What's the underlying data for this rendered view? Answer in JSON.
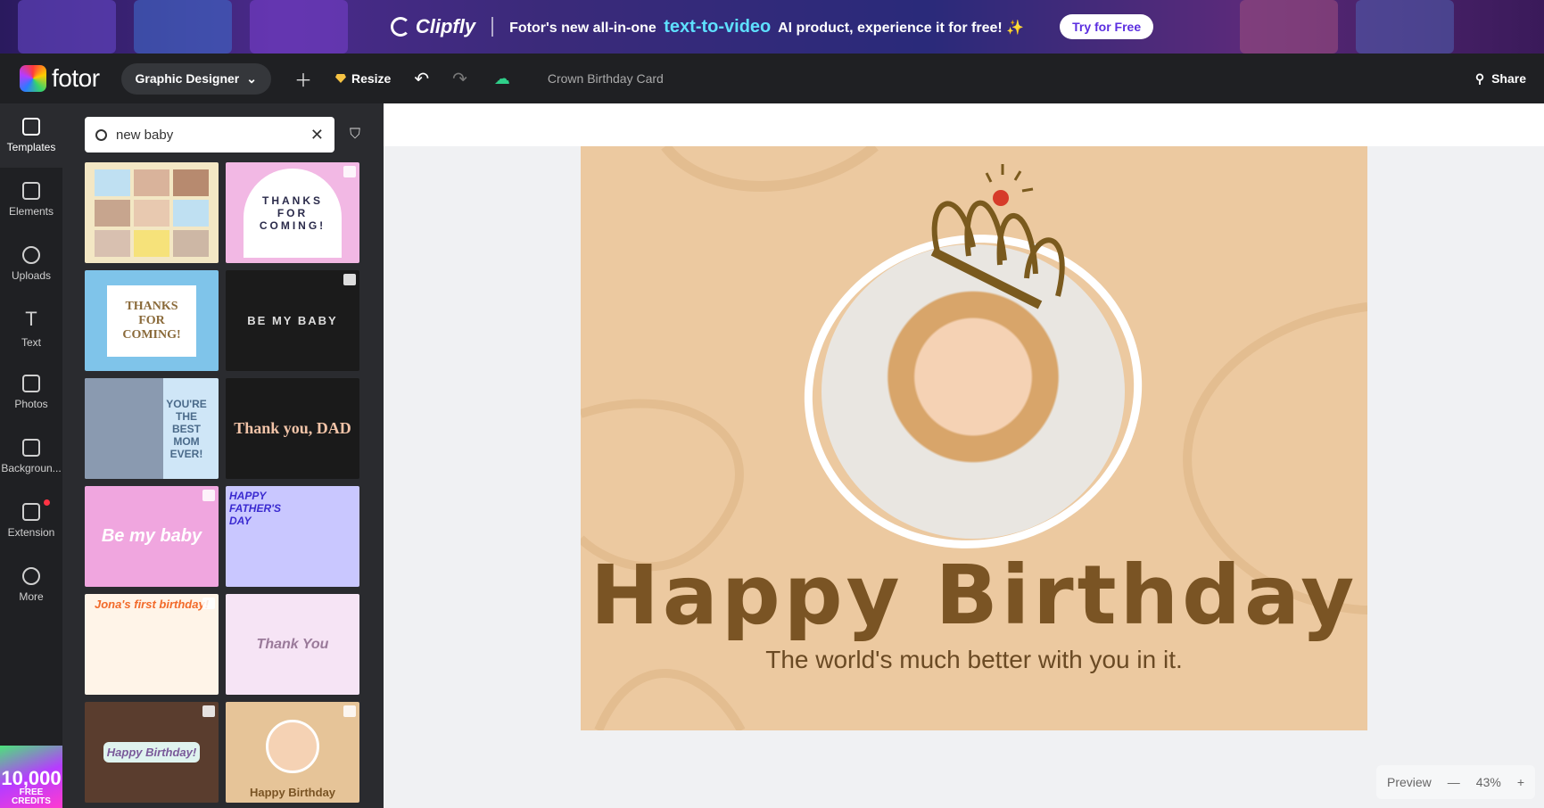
{
  "banner": {
    "brand": "Clipfly",
    "message_pre": "Fotor's new all-in-one",
    "message_highlight": "text-to-video",
    "message_post": "AI product, experience it for free!",
    "sparkle": "✨",
    "cta": "Try for Free"
  },
  "topbar": {
    "logo": "fotor",
    "role": "Graphic Designer",
    "resize": "Resize",
    "doc_title": "Crown Birthday Card",
    "share": "Share"
  },
  "rail": {
    "items": [
      {
        "label": "Templates",
        "icon": "templates-icon"
      },
      {
        "label": "Elements",
        "icon": "elements-icon"
      },
      {
        "label": "Uploads",
        "icon": "upload-icon"
      },
      {
        "label": "Text",
        "icon": "text-icon"
      },
      {
        "label": "Photos",
        "icon": "photos-icon"
      },
      {
        "label": "Backgroun...",
        "icon": "background-icon"
      },
      {
        "label": "Extension",
        "icon": "extension-icon"
      },
      {
        "label": "More",
        "icon": "more-icon"
      }
    ],
    "credits_big": "10,000",
    "credits_small": "FREE CREDITS"
  },
  "search": {
    "value": "new baby"
  },
  "templates": [
    {
      "text": "",
      "bg": "#f3e7c4"
    },
    {
      "text": "THANKS FOR COMING!",
      "bg": "#f2b8e4"
    },
    {
      "text": "THANKS FOR COMING!",
      "bg": "#7fc4ea"
    },
    {
      "text": "BE MY BABY",
      "bg": "#1b1b1b"
    },
    {
      "text": "YOU'RE THE BEST MOM EVER!",
      "bg": "#cfe6f7"
    },
    {
      "text": "Thank you, DAD",
      "bg": "#1a1a1a"
    },
    {
      "text": "Be my baby",
      "bg": "#f0a6df"
    },
    {
      "text": "HAPPY FATHER'S DAY",
      "bg": "#c9c7ff"
    },
    {
      "text": "Jona's first birthday!",
      "bg": "#fff4e8"
    },
    {
      "text": "Thank You",
      "bg": "#f6e4f5"
    },
    {
      "text": "Happy Birthday!",
      "bg": "#5a3d2e"
    },
    {
      "text": "Happy Birthday",
      "bg": "#e6c498"
    }
  ],
  "card": {
    "title": "Happy Birthday",
    "subtitle": "The world's much better with you in it."
  },
  "zoom": {
    "preview": "Preview",
    "minus": "—",
    "level": "43%",
    "plus": "+"
  }
}
